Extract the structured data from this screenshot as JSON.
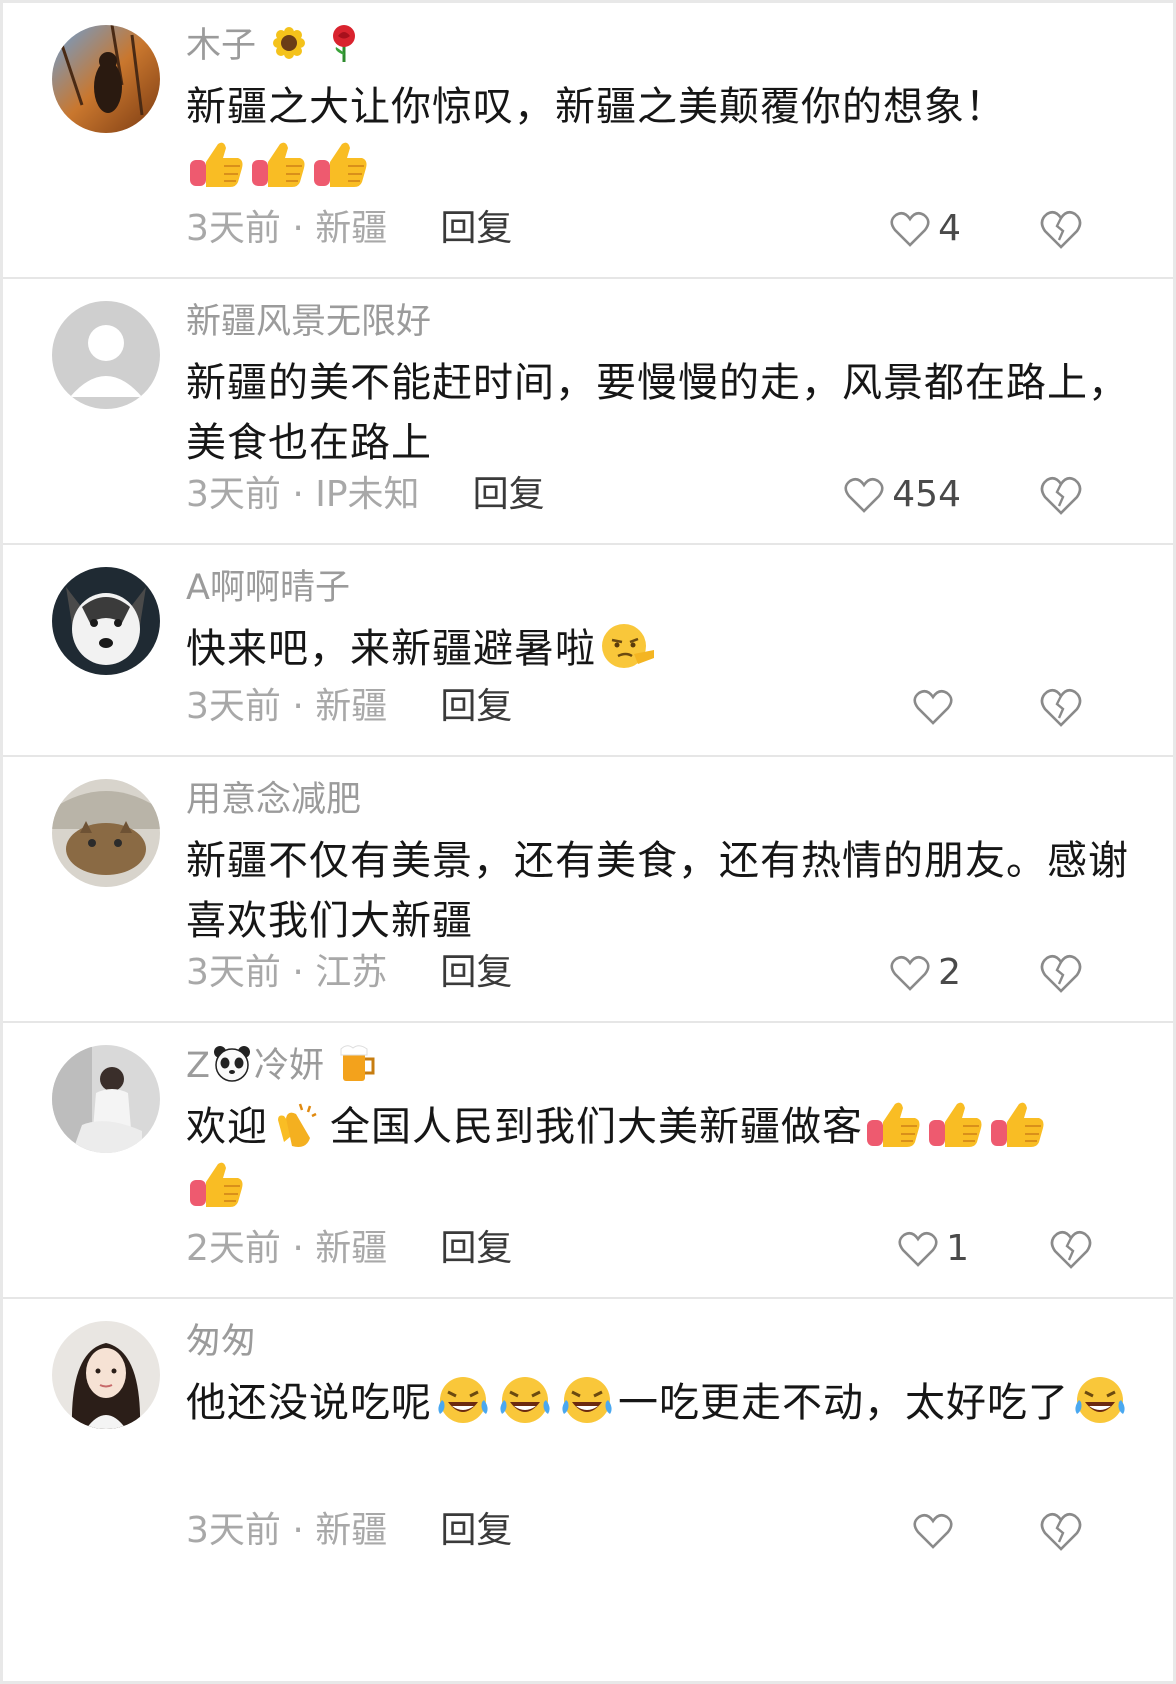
{
  "comments": [
    {
      "name": "木子",
      "name_emojis": [
        "sunflower-emoji",
        "rose-emoji"
      ],
      "text": "新疆之大让你惊叹，新疆之美颠覆你的想象！",
      "text_emojis": [
        "thumbs-up-emoji",
        "thumbs-up-emoji",
        "thumbs-up-emoji"
      ],
      "meta": "3天前 · 新疆",
      "reply": "回复",
      "likes": "4"
    },
    {
      "name": "新疆风景无限好",
      "text": "新疆的美不能赶时间，要慢慢的走，风景都在路上，美食也在路上",
      "meta": "3天前 · IP未知",
      "reply": "回复",
      "likes": "454"
    },
    {
      "name": "A啊啊晴子",
      "text": "快来吧，来新疆避暑啦",
      "text_emojis": [
        "smirk-pointing-emoji"
      ],
      "meta": "3天前 · 新疆",
      "reply": "回复",
      "likes": ""
    },
    {
      "name": "用意念减肥",
      "text": "新疆不仅有美景，还有美食，还有热情的朋友。感谢喜欢我们大新疆",
      "meta": "3天前 · 江苏",
      "reply": "回复",
      "likes": "2"
    },
    {
      "name_prefix": "Z",
      "name": "冷妍",
      "name_emojis": [
        "panda-emoji",
        "beer-emoji"
      ],
      "text_a": "欢迎",
      "text_b": "全国人民到我们大美新疆做客",
      "text_emojis": [
        "clapping-hands-emoji",
        "thumbs-up-emoji",
        "thumbs-up-emoji",
        "thumbs-up-emoji",
        "thumbs-up-emoji"
      ],
      "meta": "2天前 · 新疆",
      "reply": "回复",
      "likes": "1"
    },
    {
      "name": "匆匆",
      "text_a": "他还没说吃呢",
      "text_b": "一吃更走不动，太好吃了",
      "text_emojis": [
        "rolling-laughing-emoji",
        "rolling-laughing-emoji",
        "rolling-laughing-emoji",
        "rolling-laughing-emoji"
      ],
      "meta": "3天前 · 新疆",
      "reply": "回复",
      "likes": ""
    }
  ],
  "colors": {
    "name": "#9b9b9b",
    "text": "#161616",
    "meta": "#a8a8a8",
    "reply": "#3a3a3a",
    "divider": "#e6e6e6"
  }
}
